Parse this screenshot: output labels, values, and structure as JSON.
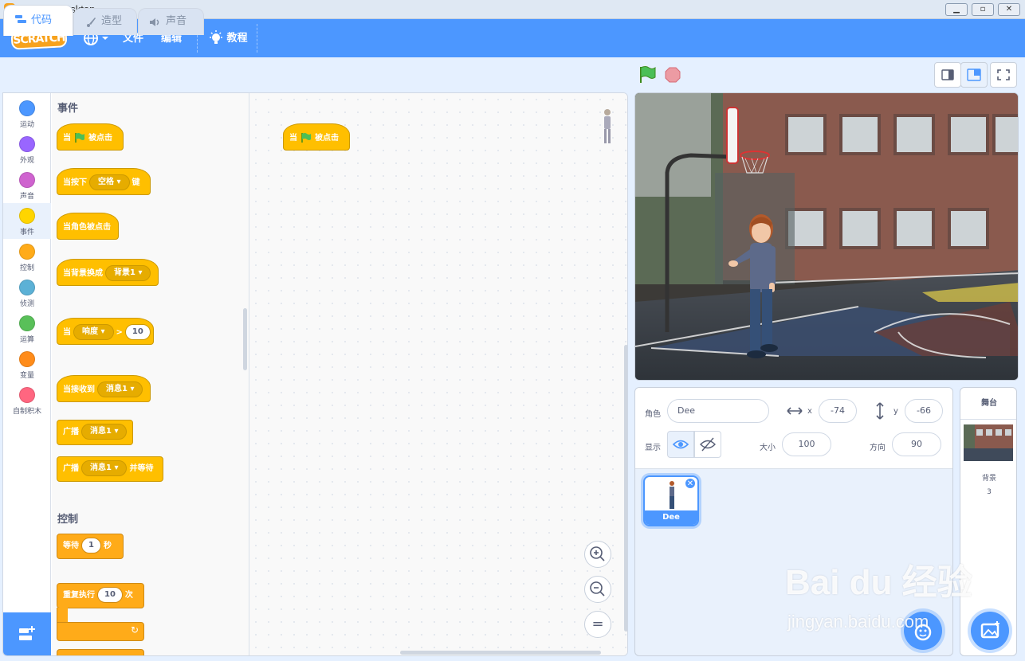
{
  "window": {
    "title": "Scratch Desktop",
    "controls": [
      "minimize",
      "maximize",
      "close"
    ]
  },
  "menubar": {
    "logo": "SCRATCH",
    "file": "文件",
    "edit": "编辑",
    "tutorials": "教程"
  },
  "tabs": [
    {
      "label": "代码"
    },
    {
      "label": "造型"
    },
    {
      "label": "声音"
    }
  ],
  "categories": [
    {
      "label": "运动",
      "color": "#4c97ff"
    },
    {
      "label": "外观",
      "color": "#9966ff"
    },
    {
      "label": "声音",
      "color": "#cf63cf"
    },
    {
      "label": "事件",
      "color": "#ffd500"
    },
    {
      "label": "控制",
      "color": "#ffab19"
    },
    {
      "label": "侦测",
      "color": "#5cb1d6"
    },
    {
      "label": "运算",
      "color": "#59c059"
    },
    {
      "label": "变量",
      "color": "#ff8c1a"
    },
    {
      "label": "自制积木",
      "color": "#ff6680"
    }
  ],
  "palette": {
    "events_title": "事件",
    "control_title": "控制",
    "blocks": {
      "when_flag": {
        "pre": "当",
        "post": "被点击"
      },
      "when_key": {
        "pre": "当按下",
        "key": "空格",
        "post": "键"
      },
      "when_sprite_clicked": "当角色被点击",
      "when_backdrop": {
        "pre": "当背景换成",
        "value": "背景1"
      },
      "when_loudness": {
        "pre": "当",
        "sensor": "响度",
        "op": ">",
        "value": "10"
      },
      "when_receive": {
        "pre": "当接收到",
        "value": "消息1"
      },
      "broadcast": {
        "pre": "广播",
        "value": "消息1"
      },
      "broadcast_wait": {
        "pre": "广播",
        "value": "消息1",
        "post": "并等待"
      },
      "wait": {
        "pre": "等待",
        "value": "1",
        "post": "秒"
      },
      "repeat": {
        "pre": "重复执行",
        "value": "10",
        "post": "次"
      }
    }
  },
  "script": {
    "block": {
      "pre": "当",
      "post": "被点击"
    }
  },
  "zoom": {
    "in": "+",
    "out": "−",
    "reset": "="
  },
  "sprite_info": {
    "sprite_label": "角色",
    "sprite_name": "Dee",
    "x_label": "x",
    "x": "-74",
    "y_label": "y",
    "y": "-66",
    "show_label": "显示",
    "size_label": "大小",
    "size": "100",
    "direction_label": "方向",
    "direction": "90"
  },
  "sprites": [
    {
      "name": "Dee"
    }
  ],
  "stage_panel": {
    "title": "舞台",
    "backdrops_label": "背景",
    "backdrops_count": "3"
  },
  "watermark": {
    "line1": "Bai du 经验",
    "line2": "jingyan.baidu.com"
  }
}
